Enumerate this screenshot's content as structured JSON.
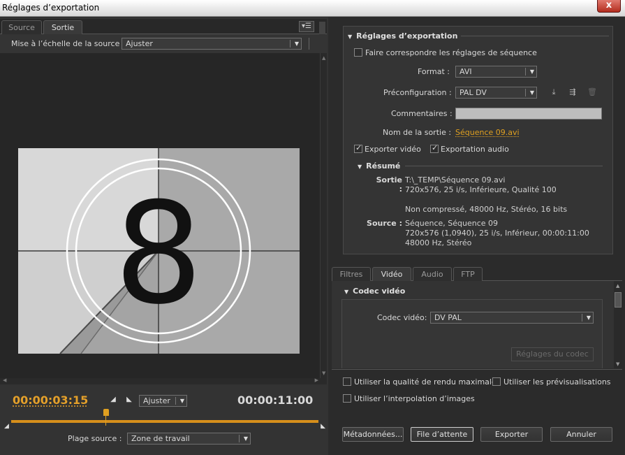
{
  "window": {
    "title": "Réglages d’exportation",
    "close_label": "x"
  },
  "left": {
    "tabs": [
      {
        "label": "Source"
      },
      {
        "label": "Sortie"
      }
    ],
    "scale": {
      "label": "Mise à l’échelle de la source :",
      "value": "Ajuster"
    },
    "preview": {
      "countdown_number": "8"
    },
    "playback": {
      "current_time": "00:00:03:15",
      "total_time": "00:00:11:00",
      "zoom_value": "Ajuster",
      "playhead_fraction": 0.31
    },
    "range": {
      "label": "Plage source :",
      "value": "Zone de travail"
    }
  },
  "export": {
    "section_title": "Réglages d’exportation",
    "match_sequence_label": "Faire correspondre les réglages de séquence",
    "format_label": "Format :",
    "format_value": "AVI",
    "preset_label": "Préconfiguration :",
    "preset_value": "PAL DV",
    "comments_label": "Commentaires :",
    "comments_value": "",
    "output_name_label": "Nom de la sortie :",
    "output_name_value": "Séquence 09.avi",
    "export_video_label": "Exporter vidéo",
    "export_audio_label": "Exportation audio",
    "summary": {
      "title": "Résumé",
      "output_key": "Sortie :",
      "output_lines": [
        "T:\\_TEMP\\Séquence 09.avi",
        "720x576, 25 i/s, Inférieure, Qualité  100",
        "",
        "Non compressé, 48000 Hz, Stéréo, 16 bits"
      ],
      "source_key": "Source :",
      "source_lines": [
        "Séquence, Séquence 09",
        "720x576 (1,0940), 25  i/s, Inférieur, 00:00:11:00",
        "48000 Hz, Stéréo"
      ]
    }
  },
  "settings_tabs": [
    {
      "label": "Filtres"
    },
    {
      "label": "Vidéo"
    },
    {
      "label": "Audio"
    },
    {
      "label": "FTP"
    }
  ],
  "codec": {
    "section_title": "Codec vidéo",
    "label": "Codec vidéo:",
    "value": "DV PAL",
    "settings_button": "Réglages du codec"
  },
  "options": {
    "max_quality": "Utiliser la qualité de rendu maximale",
    "previews": "Utiliser les prévisualisations",
    "frame_blending": "Utiliser l’interpolation d’images"
  },
  "buttons": {
    "metadata": "Métadonnées...",
    "queue": "File d’attente",
    "export": "Exporter",
    "cancel": "Annuler"
  }
}
